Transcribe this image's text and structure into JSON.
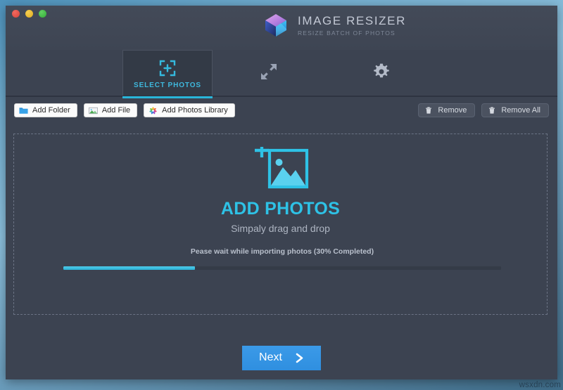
{
  "window": {
    "traffic_lights": [
      {
        "name": "close",
        "color": "#e0483f"
      },
      {
        "name": "minimize",
        "color": "#e5b21f"
      },
      {
        "name": "zoom",
        "color": "#35ad38"
      }
    ]
  },
  "brand": {
    "logo_icon": "image-resizer-logo-icon",
    "title": "IMAGE RESIZER",
    "subtitle": "RESIZE BATCH OF PHOTOS"
  },
  "tabs": [
    {
      "id": "select-photos",
      "label": "SELECT PHOTOS",
      "icon": "select-photos-icon",
      "active": true
    },
    {
      "id": "resize",
      "label": "",
      "icon": "resize-arrows-icon",
      "active": false
    },
    {
      "id": "settings",
      "label": "",
      "icon": "gear-icon",
      "active": false
    }
  ],
  "toolbar": {
    "left": [
      {
        "id": "add-folder",
        "label": "Add Folder",
        "icon": "folder-icon"
      },
      {
        "id": "add-file",
        "label": "Add File",
        "icon": "picture-icon"
      },
      {
        "id": "add-photos-library",
        "label": "Add Photos Library",
        "icon": "photos-pinwheel-icon"
      }
    ],
    "right": [
      {
        "id": "remove",
        "label": "Remove",
        "icon": "trash-icon"
      },
      {
        "id": "remove-all",
        "label": "Remove All",
        "icon": "trash-icon"
      }
    ]
  },
  "dropzone": {
    "icon": "add-photos-placeholder-icon",
    "title": "ADD PHOTOS",
    "subtitle": "Simpaly drag and drop",
    "progress": {
      "label": "Pease wait while importing photos (30% Completed)",
      "percent": 30,
      "fill_color": "#2bb4d8",
      "track_color": "#343b47"
    }
  },
  "footer": {
    "next_label": "Next",
    "next_icon": "chevron-right-icon",
    "next_color": "#2f8fe0"
  },
  "watermark": {
    "text": "wsxdn.com"
  },
  "colors": {
    "window_bg": "#3c4351",
    "accent": "#2ec2e6",
    "tab_active_bg": "#333a46",
    "tab_underline": "#29b6da"
  }
}
